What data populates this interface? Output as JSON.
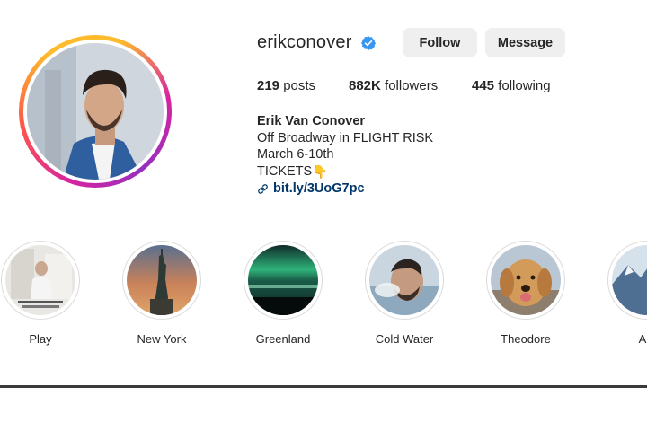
{
  "profile": {
    "username": "erikconover",
    "verified": true,
    "follow_label": "Follow",
    "message_label": "Message",
    "stats": {
      "posts_count": "219",
      "posts_label": "posts",
      "followers_count": "882K",
      "followers_label": "followers",
      "following_count": "445",
      "following_label": "following"
    },
    "bio": {
      "name": "Erik Van Conover",
      "line1": "Off Broadway in FLIGHT RISK",
      "line2": "March 6-10th",
      "line3": "TICKETS",
      "link": "bit.ly/3UoG7pc"
    }
  },
  "highlights": [
    {
      "label": "Play"
    },
    {
      "label": "New York"
    },
    {
      "label": "Greenland"
    },
    {
      "label": "Cold Water"
    },
    {
      "label": "Theodore"
    },
    {
      "label": "Ala"
    }
  ],
  "colors": {
    "text": "#262626",
    "button_bg": "#efefef",
    "link": "#00376b",
    "verified": "#3897f0",
    "story_ring_start": "#d6249f",
    "story_ring_end": "#fdbb2d"
  },
  "icons": {
    "verified": "verified-badge-icon",
    "link": "link-icon",
    "pointer": "pointing-hand-icon"
  }
}
